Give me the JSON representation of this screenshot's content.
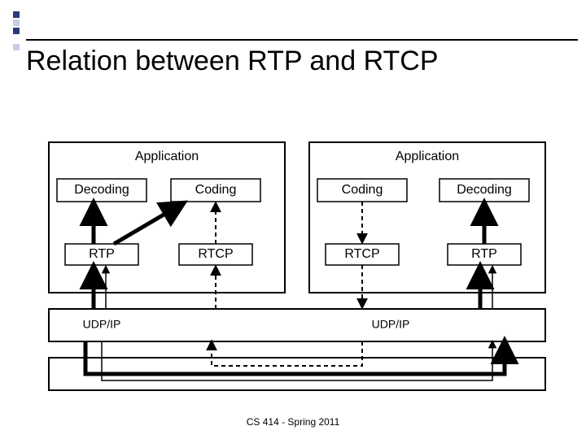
{
  "title": "Relation between RTP and RTCP",
  "footer": "CS 414 - Spring 2011",
  "left": {
    "app": "Application",
    "boxes": [
      "Decoding",
      "Coding",
      "RTP",
      "RTCP"
    ],
    "udp": "UDP/IP"
  },
  "right": {
    "app": "Application",
    "boxes": [
      "Coding",
      "Decoding",
      "RTCP",
      "RTP"
    ],
    "udp": "UDP/IP"
  }
}
